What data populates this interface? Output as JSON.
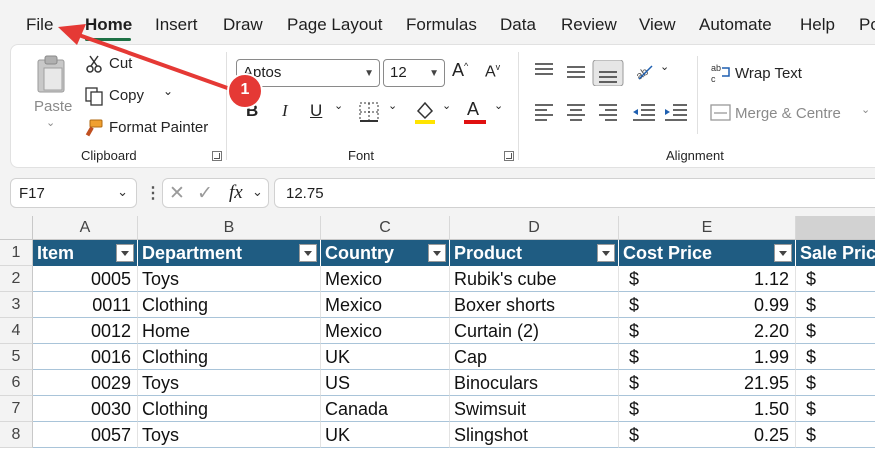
{
  "tabs": {
    "file": "File",
    "home": "Home",
    "insert": "Insert",
    "draw": "Draw",
    "page_layout": "Page Layout",
    "formulas": "Formulas",
    "data": "Data",
    "review": "Review",
    "view": "View",
    "automate": "Automate",
    "help": "Help",
    "po": "Po"
  },
  "clipboard": {
    "paste": "Paste",
    "cut": "Cut",
    "copy": "Copy",
    "format_painter": "Format Painter",
    "label": "Clipboard"
  },
  "font": {
    "name": "Aptos",
    "size": "12",
    "bold": "B",
    "italic": "I",
    "underline": "U",
    "color_letter": "A",
    "grow": "A",
    "shrink": "A",
    "label": "Font"
  },
  "alignment": {
    "wrap": "Wrap Text",
    "merge": "Merge & Centre",
    "label": "Alignment"
  },
  "formula_bar": {
    "name_box": "F17",
    "fx": "fx",
    "value": "12.75"
  },
  "annotation": {
    "badge": "1"
  },
  "grid": {
    "columns": [
      "A",
      "B",
      "C",
      "D",
      "E"
    ],
    "rows": [
      "1",
      "2",
      "3",
      "4",
      "5",
      "6",
      "7",
      "8"
    ],
    "headers": [
      "Item",
      "Department",
      "Country",
      "Product",
      "Cost Price",
      "Sale Price"
    ],
    "currency": "$",
    "data": [
      [
        "0005",
        "Toys",
        "Mexico",
        "Rubik's cube",
        "1.12"
      ],
      [
        "0011",
        "Clothing",
        "Mexico",
        "Boxer shorts",
        "0.99"
      ],
      [
        "0012",
        "Home",
        "Mexico",
        "Curtain (2)",
        "2.20"
      ],
      [
        "0016",
        "Clothing",
        "UK",
        "Cap",
        "1.99"
      ],
      [
        "0029",
        "Toys",
        "US",
        "Binoculars",
        "21.95"
      ],
      [
        "0030",
        "Clothing",
        "Canada",
        "Swimsuit",
        "1.50"
      ],
      [
        "0057",
        "Toys",
        "UK",
        "Slingshot",
        "0.25"
      ]
    ]
  },
  "colors": {
    "table_header": "#1f5c82",
    "accent_green": "#1e7145",
    "annotation_red": "#e53935"
  }
}
